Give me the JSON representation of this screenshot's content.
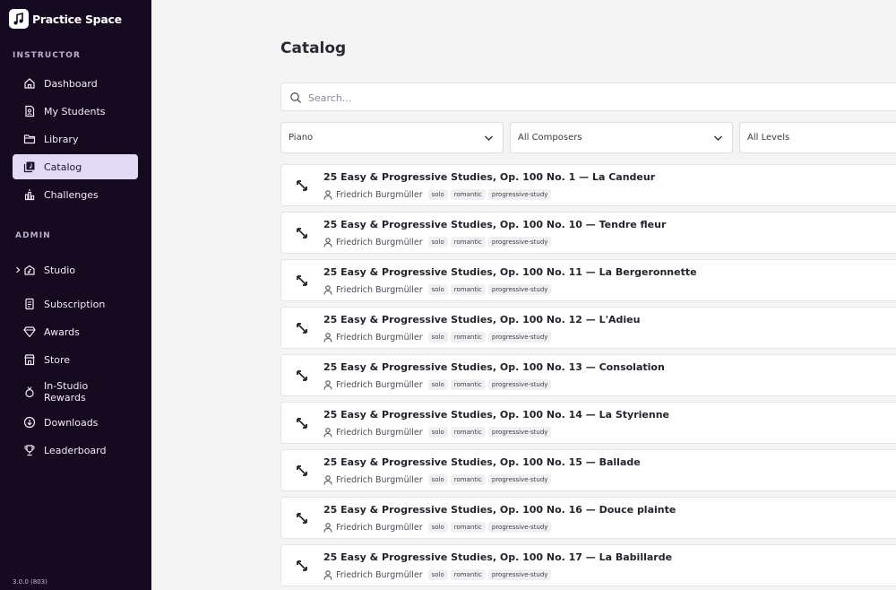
{
  "app": {
    "name": "Practice Space",
    "version": "3.0.0 (803)"
  },
  "sidebar": {
    "instructor_label": "INSTRUCTOR",
    "instructor_items": [
      {
        "label": "Dashboard",
        "icon": "home-icon"
      },
      {
        "label": "My Students",
        "icon": "students-icon"
      },
      {
        "label": "Library",
        "icon": "folder-icon"
      },
      {
        "label": "Catalog",
        "icon": "catalog-icon",
        "active": true
      },
      {
        "label": "Challenges",
        "icon": "challenges-icon"
      }
    ],
    "admin_label": "ADMIN",
    "admin_items": [
      {
        "label": "Studio",
        "icon": "studio-icon",
        "expandable": true
      },
      {
        "label": "Subscription",
        "icon": "subscription-icon"
      },
      {
        "label": "Awards",
        "icon": "awards-icon"
      },
      {
        "label": "Store",
        "icon": "store-icon"
      },
      {
        "label_line1": "In-Studio",
        "label_line2": "Rewards",
        "icon": "rewards-icon"
      },
      {
        "label": "Downloads",
        "icon": "downloads-icon"
      },
      {
        "label": "Leaderboard",
        "icon": "leaderboard-icon"
      }
    ]
  },
  "main": {
    "title": "Catalog",
    "search": {
      "placeholder": "Search..."
    },
    "filters": {
      "instrument": "Piano",
      "composer": "All Composers",
      "level": "All Levels"
    },
    "pieces": [
      {
        "title": "25 Easy & Progressive Studies, Op. 100 No. 1 — La Candeur",
        "composer": "Friedrich Burgmüller",
        "tags": [
          "solo",
          "romantic",
          "progressive-study"
        ]
      },
      {
        "title": "25 Easy & Progressive Studies, Op. 100 No. 10 — Tendre fleur",
        "composer": "Friedrich Burgmüller",
        "tags": [
          "solo",
          "romantic",
          "progressive-study"
        ]
      },
      {
        "title": "25 Easy & Progressive Studies, Op. 100 No. 11 — La Bergeronnette",
        "composer": "Friedrich Burgmüller",
        "tags": [
          "solo",
          "romantic",
          "progressive-study"
        ]
      },
      {
        "title": "25 Easy & Progressive Studies, Op. 100 No. 12 — L'Adieu",
        "composer": "Friedrich Burgmüller",
        "tags": [
          "solo",
          "romantic",
          "progressive-study"
        ]
      },
      {
        "title": "25 Easy & Progressive Studies, Op. 100 No. 13 — Consolation",
        "composer": "Friedrich Burgmüller",
        "tags": [
          "solo",
          "romantic",
          "progressive-study"
        ]
      },
      {
        "title": "25 Easy & Progressive Studies, Op. 100 No. 14 — La Styrienne",
        "composer": "Friedrich Burgmüller",
        "tags": [
          "solo",
          "romantic",
          "progressive-study"
        ]
      },
      {
        "title": "25 Easy & Progressive Studies, Op. 100 No. 15 — Ballade",
        "composer": "Friedrich Burgmüller",
        "tags": [
          "solo",
          "romantic",
          "progressive-study"
        ]
      },
      {
        "title": "25 Easy & Progressive Studies, Op. 100 No. 16 — Douce plainte",
        "composer": "Friedrich Burgmüller",
        "tags": [
          "solo",
          "romantic",
          "progressive-study"
        ]
      },
      {
        "title": "25 Easy & Progressive Studies, Op. 100 No. 17 — La Babillarde",
        "composer": "Friedrich Burgmüller",
        "tags": [
          "solo",
          "romantic",
          "progressive-study"
        ]
      }
    ]
  }
}
